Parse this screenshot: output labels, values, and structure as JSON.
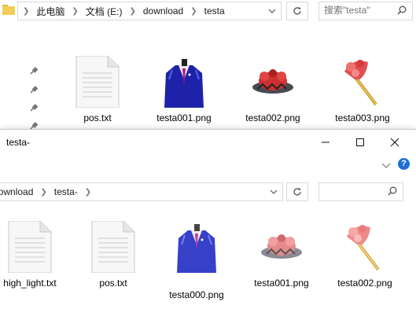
{
  "back_window": {
    "breadcrumb": [
      "此电脑",
      "文档 (E:)",
      "download",
      "testa"
    ],
    "search_placeholder": "搜索\"testa\"",
    "files": [
      {
        "name": "pos.txt",
        "kind": "text"
      },
      {
        "name": "testa001.png",
        "kind": "suit"
      },
      {
        "name": "testa002.png",
        "kind": "creature"
      },
      {
        "name": "testa003.png",
        "kind": "fan"
      }
    ]
  },
  "front_window": {
    "title": "testa-",
    "breadcrumb": [
      "download",
      "testa-"
    ],
    "search_placeholder": "",
    "files": [
      {
        "name": "high_light.txt",
        "kind": "text"
      },
      {
        "name": "pos.txt",
        "kind": "text"
      },
      {
        "name": "testa000.png",
        "kind": "suit"
      },
      {
        "name": "testa001.png",
        "kind": "creature"
      },
      {
        "name": "testa002.png",
        "kind": "fan"
      }
    ]
  },
  "colors": {
    "help_blue": "#1e6fd0",
    "folder_yellow": "#e8b83c"
  }
}
